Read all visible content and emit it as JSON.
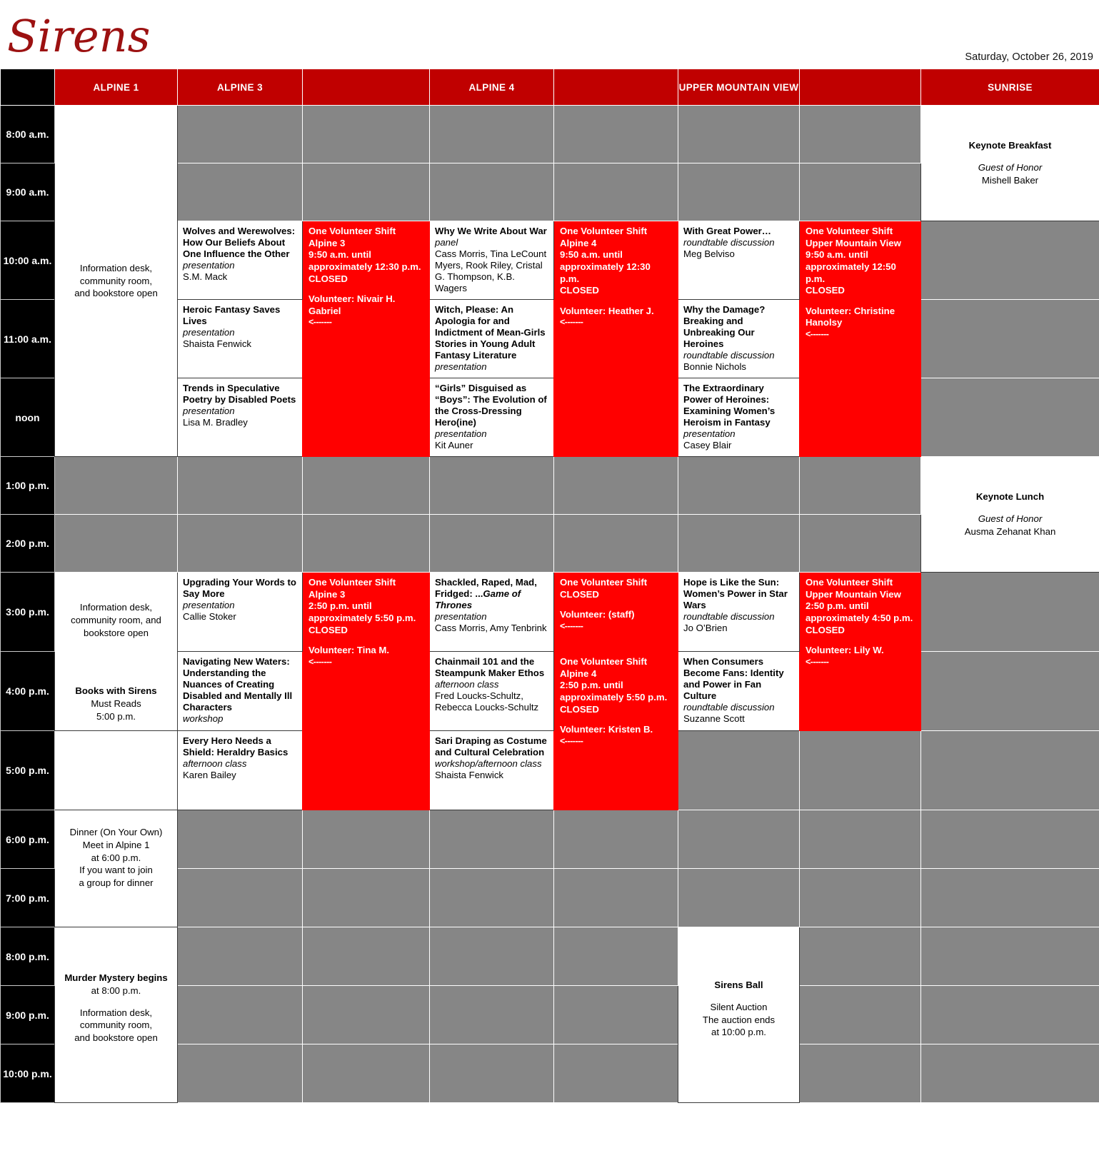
{
  "brand": {
    "logo_text": "Sirens"
  },
  "date_label": "Saturday, October 26, 2019",
  "columns": {
    "time_header": "",
    "alpine1": "ALPINE 1",
    "alpine3": "ALPINE 3",
    "vol_alpine3": "",
    "alpine4": "ALPINE 4",
    "vol_alpine4": "",
    "upper_mountain_view": "UPPER MOUNTAIN VIEW",
    "vol_umv": "",
    "sunrise": "SUNRISE"
  },
  "times": {
    "t8am": "8:00 a.m.",
    "t9am": "9:00 a.m.",
    "t10am": "10:00 a.m.",
    "t11am": "11:00 a.m.",
    "noon": "noon",
    "t1pm": "1:00 p.m.",
    "t2pm": "2:00 p.m.",
    "t3pm": "3:00 p.m.",
    "t4pm": "4:00 p.m.",
    "t5pm": "5:00 p.m.",
    "t6pm": "6:00 p.m.",
    "t7pm": "7:00 p.m.",
    "t8pm": "8:00 p.m.",
    "t9pm": "9:00 p.m.",
    "t10pm": "10:00 p.m."
  },
  "alpine1": {
    "morning": "Information desk,\ncommunity room,\nand bookstore open",
    "afternoon_info": "Information desk, community room, and bookstore open",
    "books_title": "Books with Sirens",
    "books_sub": "Must Reads",
    "books_time": "5:00 p.m.",
    "dinner_l1": "Dinner (On Your Own)",
    "dinner_l2": "Meet in Alpine 1",
    "dinner_l3": "at 6:00 p.m.",
    "dinner_l4": "If you want to join",
    "dinner_l5": "a group for dinner",
    "murder_l1": "Murder Mystery begins",
    "murder_l2": "at 8:00 p.m.",
    "evening_l1": "Information desk,",
    "evening_l2": "community room,",
    "evening_l3": "and bookstore open"
  },
  "sunrise": {
    "breakfast_title": "Keynote Breakfast",
    "breakfast_goh_label": "Guest of Honor",
    "breakfast_goh": "Mishell Baker",
    "lunch_title": "Keynote Lunch",
    "lunch_goh_label": "Guest of Honor",
    "lunch_goh": "Ausma Zehanat Khan"
  },
  "umv_evening": {
    "title": "Sirens Ball",
    "l1": "Silent Auction",
    "l2": "The auction ends",
    "l3": "at 10:00 p.m."
  },
  "sessions": {
    "a3_m1": {
      "title": "Wolves and Werewolves: How Our Beliefs About One Influence the Other",
      "kind": "presentation",
      "who": "S.M. Mack"
    },
    "a3_m2": {
      "title": "Heroic Fantasy Saves Lives",
      "kind": "presentation",
      "who": "Shaista Fenwick"
    },
    "a3_m3": {
      "title": "Trends in Speculative Poetry by Disabled Poets",
      "kind": "presentation",
      "who": "Lisa M. Bradley"
    },
    "a4_m1": {
      "title": "Why We Write About War",
      "kind": "panel",
      "who": "Cass Morris, Tina LeCount Myers, Rook Riley, Cristal G. Thompson, K.B. Wagers"
    },
    "a4_m2": {
      "title": "Witch, Please: An Apologia for and Indictment of Mean-Girls Stories in Young Adult Fantasy Literature",
      "kind": "presentation",
      "who": ""
    },
    "a4_m3": {
      "title": "“Girls” Disguised as “Boys”: The Evolution of the Cross-Dressing Hero(ine)",
      "kind": "presentation",
      "who": "Kit Auner"
    },
    "umv_m1": {
      "title": "With Great Power…",
      "kind": "roundtable discussion",
      "who": "Meg Belviso"
    },
    "umv_m2": {
      "title": "Why the Damage? Breaking and Unbreaking Our Heroines",
      "kind": "roundtable discussion",
      "who": "Bonnie Nichols"
    },
    "umv_m3": {
      "title": "The Extraordinary Power of Heroines: Examining Women’s Heroism in Fantasy",
      "kind": "presentation",
      "who": "Casey Blair"
    },
    "a3_p1": {
      "title": "Upgrading Your Words to Say More",
      "kind": "presentation",
      "who": "Callie Stoker"
    },
    "a3_p2": {
      "title": "Navigating New Waters: Understanding the Nuances of Creating Disabled and Mentally Ill Characters",
      "kind": "workshop",
      "who": ""
    },
    "a3_p3": {
      "title": "Every Hero Needs a Shield: Heraldry Basics",
      "kind": "afternoon class",
      "who": "Karen Bailey"
    },
    "a4_p1": {
      "title_pre": "Shackled, Raped, Mad, Fridged: ...",
      "title_em": "Game of Thrones",
      "kind": "presentation",
      "who": "Cass Morris, Amy Tenbrink"
    },
    "a4_p2": {
      "title": "Chainmail 101 and the Steampunk Maker Ethos",
      "kind": "afternoon class",
      "who": "Fred Loucks-Schultz, Rebecca Loucks-Schultz"
    },
    "a4_p3": {
      "title": "Sari Draping as Costume and Cultural Celebration",
      "kind": "workshop/afternoon class",
      "who": "Shaista Fenwick"
    },
    "umv_p1": {
      "title": "Hope is Like the Sun: Women’s Power in Star Wars",
      "kind": "roundtable discussion",
      "who": "Jo O’Brien"
    },
    "umv_p2": {
      "title": "When Consumers Become Fans: Identity and Power in Fan Culture",
      "kind": "roundtable discussion",
      "who": "Suzanne Scott"
    }
  },
  "volunteer_shifts": {
    "a3_am": {
      "l1": "One Volunteer Shift",
      "l2": "Alpine 3",
      "l3": "9:50 a.m. until",
      "l4": "approximately 12:30 p.m.",
      "l5": "CLOSED",
      "l6": "Volunteer: Nivair H. Gabriel",
      "arrow": "<-------"
    },
    "a4_am": {
      "l1": "One Volunteer Shift",
      "l2": "Alpine 4",
      "l3": "9:50 a.m. until",
      "l4": "approximately 12:30 p.m.",
      "l5": "CLOSED",
      "l6": "Volunteer: Heather J.",
      "arrow": "<-------"
    },
    "umv_am": {
      "l1": "One Volunteer Shift",
      "l2": "Upper Mountain View",
      "l3": "9:50 a.m. until",
      "l4": "approximately 12:50 p.m.",
      "l5": "CLOSED",
      "l6": "Volunteer: Christine Hanolsy",
      "arrow": "<-------"
    },
    "a3_pm": {
      "l1": "One Volunteer Shift",
      "l2": "Alpine 3",
      "l3": "2:50 p.m. until",
      "l4": "approximately 5:50 p.m.",
      "l5": "CLOSED",
      "l6": "Volunteer: Tina M.",
      "arrow": "<-------"
    },
    "a4_pm_early": {
      "l1": "One Volunteer Shift",
      "l5": "CLOSED",
      "l6": "Volunteer: (staff)",
      "arrow": "<-------"
    },
    "a4_pm_late": {
      "l1": "One Volunteer Shift",
      "l2": "Alpine 4",
      "l3": "2:50 p.m. until",
      "l4": "approximately 5:50 p.m.",
      "l5": "CLOSED",
      "l6": "Volunteer: Kristen B.",
      "arrow": "<-------"
    },
    "umv_pm": {
      "l1": "One Volunteer Shift",
      "l2": "Upper Mountain View",
      "l3": "2:50 p.m. until",
      "l4": "approximately 4:50 p.m.",
      "l5": "CLOSED",
      "l6": "Volunteer: Lily W.",
      "arrow": "<-------"
    }
  }
}
